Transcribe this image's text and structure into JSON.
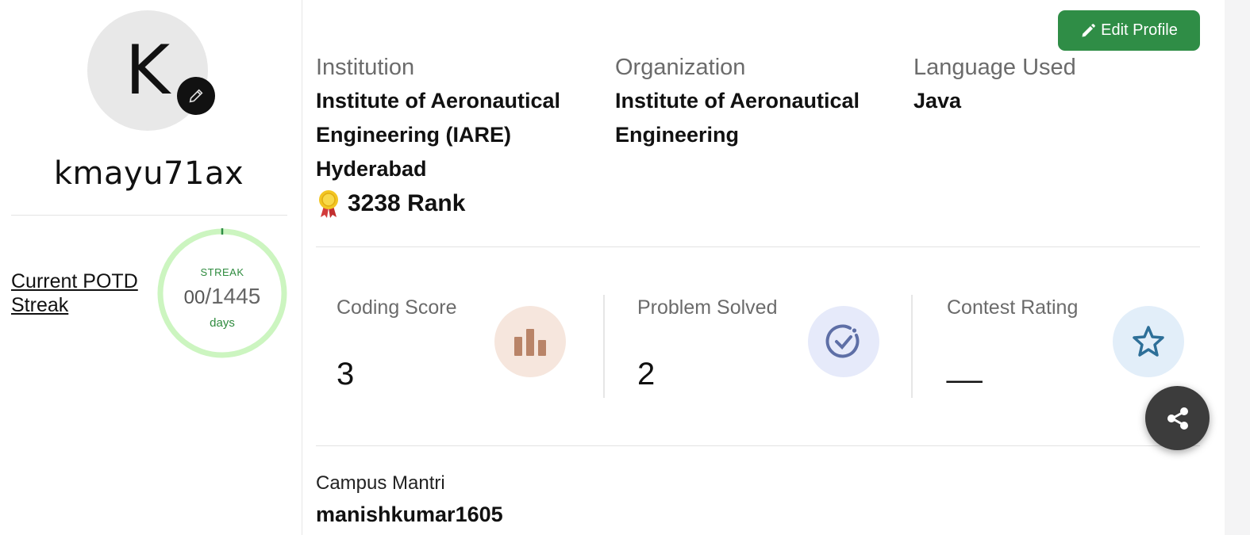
{
  "profile": {
    "avatar_initial": "K",
    "username": "kmayu71ax"
  },
  "potd": {
    "link_label": "Current POTD Streak",
    "streak_label": "STREAK",
    "current": "00",
    "separator": "/",
    "best": "1445",
    "unit": "days"
  },
  "header": {
    "edit_label": "Edit Profile"
  },
  "details": {
    "institution_label": "Institution",
    "institution_value": "Institute of Aeronautical Engineering (IARE) Hyderabad",
    "organization_label": "Organization",
    "organization_value": "Institute of Aeronautical Engineering",
    "language_label": "Language Used",
    "language_value": "Java",
    "rank_text": "3238 Rank"
  },
  "stats": {
    "coding_score_label": "Coding Score",
    "coding_score_value": "3",
    "problems_label": "Problem Solved",
    "problems_value": "2",
    "contest_label": "Contest Rating",
    "contest_value": "__"
  },
  "campus": {
    "label": "Campus Mantri",
    "value": "manishkumar1605"
  },
  "colors": {
    "brand_green": "#2f8d46",
    "streak_ring": "#ccf5c0",
    "coding_icon_bg": "#f6e6dd",
    "problems_icon_bg": "#e6eafa",
    "contest_icon_bg": "#e2eef9"
  },
  "icons": {
    "avatar_edit": "pencil-icon",
    "edit_profile": "pencil-icon",
    "rank": "medal-icon",
    "coding_score": "bar-chart-icon",
    "problems": "check-circle-icon",
    "contest": "star-icon",
    "share": "share-icon"
  }
}
